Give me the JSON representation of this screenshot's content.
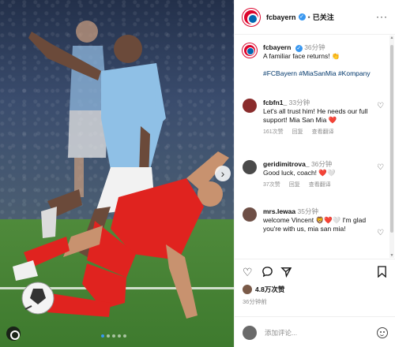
{
  "header": {
    "username": "fcbayern",
    "separator": "•",
    "follow_status": "已关注",
    "more": "···"
  },
  "caption": {
    "username": "fcbayern",
    "time": "36分钟",
    "text": "A familiar face returns! 👏",
    "tags": "#FCBayern #MiaSanMia #Kompany"
  },
  "comments": [
    {
      "username": "fcbfn1_",
      "time": "33分钟",
      "text": "Let's all trust him! He needs our full support! Mia San Mia ❤️",
      "likes": "161次赞",
      "reply": "回复",
      "translate": "查看翻译"
    },
    {
      "username": "geridimitrova_",
      "time": "36分钟",
      "text": "Good luck, coach! ❤️🤍",
      "likes": "37次赞",
      "reply": "回复",
      "translate": "查看翻译"
    },
    {
      "username": "mrs.lewaa",
      "time": "35分钟",
      "text": "welcome Vincent 🦁❤️🤍 I'm glad you're with us, mia san mia!",
      "likes": "",
      "reply": "",
      "translate": ""
    }
  ],
  "footer": {
    "likes": "4.8万次赞",
    "posted": "36分钟前",
    "comment_placeholder": "添加评论..."
  },
  "icons": {
    "heart": "heart-icon",
    "comment": "comment-icon",
    "share": "share-icon",
    "save": "bookmark-icon",
    "emoji": "emoji-icon"
  },
  "colors": {
    "brand_red": "#dc052d",
    "verified_blue": "#3897f0",
    "hashtag_blue": "#00376b",
    "heart_red": "#e0245e"
  }
}
